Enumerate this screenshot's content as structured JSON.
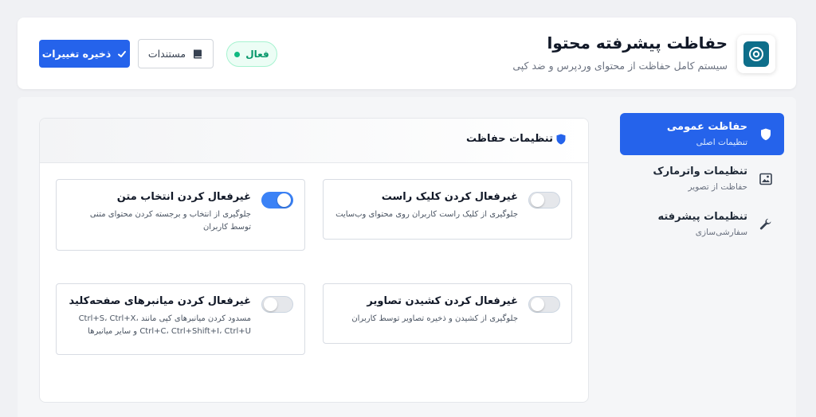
{
  "header": {
    "title": "حفاظت پیشرفته محتوا",
    "subtitle": "سیستم کامل حفاظت از محتوای وردپرس و ضد کپی",
    "status_label": "فعال",
    "docs_label": "مستندات",
    "save_label": "ذخیره تغییرات"
  },
  "sidebar": {
    "items": [
      {
        "label": "حفاظت عمومی",
        "sub": "تنظیمات اصلی",
        "icon": "shield-icon",
        "active": true
      },
      {
        "label": "تنظیمات واترمارک",
        "sub": "حفاظت از تصویر",
        "icon": "image-icon",
        "active": false
      },
      {
        "label": "تنظیمات پیشرفته",
        "sub": "سفارشی‌سازی",
        "icon": "wrench-icon",
        "active": false
      }
    ]
  },
  "panel": {
    "title": "تنظیمات حفاظت",
    "cards": [
      {
        "title": "غیرفعال کردن کلیک راست",
        "desc": "جلوگیری از کلیک راست کاربران روی محتوای وب‌سایت",
        "enabled": false
      },
      {
        "title": "غیرفعال کردن انتخاب متن",
        "desc": "جلوگیری از انتخاب و برجسته کردن محتوای متنی توسط کاربران",
        "enabled": true
      },
      {
        "title": "غیرفعال کردن کشیدن تصاویر",
        "desc": "جلوگیری از کشیدن و ذخیره تصاویر توسط کاربران",
        "enabled": false
      },
      {
        "title": "غیرفعال کردن میانبرهای صفحه‌کلید",
        "desc": "مسدود کردن میانبرهای کپی مانند Ctrl+S، Ctrl+X، Ctrl+C، Ctrl+Shift+I، Ctrl+U و سایر میانبرها",
        "enabled": false
      }
    ]
  },
  "colors": {
    "accent": "#2563eb",
    "status_green": "#10b981",
    "logo_bg": "#0e6e8a"
  }
}
